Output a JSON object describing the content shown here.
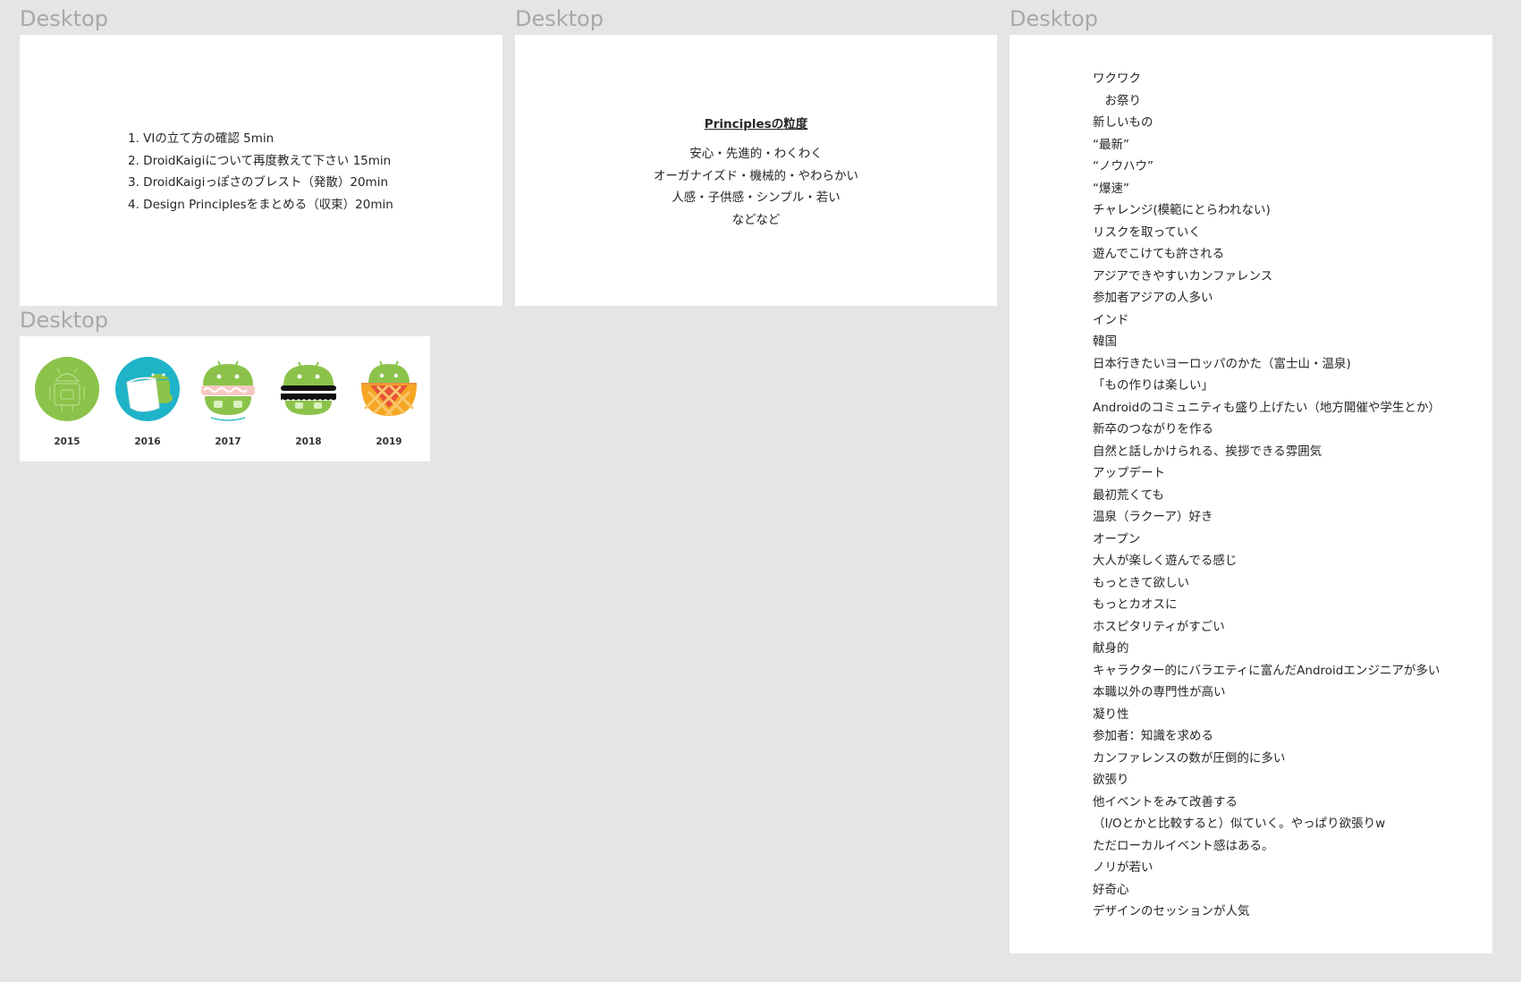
{
  "frames": {
    "agenda": {
      "label": "Desktop",
      "items": [
        "1. VIの立て方の確認 5min",
        "2. DroidKaigiについて再度教えて下さい  15min",
        "3. DroidKaigiっぽさのブレスト（発散）20min",
        "4. Design Principlesをまとめる（収束）20min"
      ]
    },
    "principles": {
      "label": "Desktop",
      "heading": "Principlesの粒度",
      "lines": [
        "安心・先進的・わくわく",
        "オーガナイズド・機械的・やわらかい",
        "人感・子供感・シンプル・若い",
        "などなど"
      ]
    },
    "notes": {
      "label": "Desktop",
      "items": [
        "ワクワク",
        "　お祭り",
        "新しいもの",
        "“最新”",
        "“ノウハウ”",
        "“爆速”",
        "チャレンジ(模範にとらわれない)",
        "リスクを取っていく",
        "遊んでこけても許される",
        "アジアできやすいカンファレンス",
        "参加者アジアの人多い",
        "インド",
        "韓国",
        "日本行きたいヨーロッパのかた（富士山・温泉)",
        "「もの作りは楽しい」",
        "Androidのコミュニティも盛り上げたい（地方開催や学生とか）",
        "新卒のつながりを作る",
        "自然と話しかけられる、挨拶できる雰囲気",
        "アップデート",
        "最初荒くても",
        "温泉（ラクーア）好き",
        "オープン",
        "大人が楽しく遊んでる感じ",
        "もっときて欲しい",
        "もっとカオスに",
        "ホスピタリティがすごい",
        "献身的",
        "キャラクター的にバラエティに富んだAndroidエンジニアが多い",
        "本職以外の専門性が高い",
        "凝り性",
        "参加者：知識を求める",
        "カンファレンスの数が圧倒的に多い",
        "欲張り",
        "他イベントをみて改善する",
        "（I/Oとかと比較すると）似ていく。やっぱり欲張りw",
        "ただローカルイベント感はある。",
        "ノリが若い",
        "好奇心",
        "デザインのセッションが人気"
      ]
    },
    "logos": {
      "label": "Desktop",
      "items": [
        {
          "year": "2015",
          "icon": "robot-outline-icon"
        },
        {
          "year": "2016",
          "icon": "robot-cake-icon"
        },
        {
          "year": "2017",
          "icon": "robot-sandwich-icon"
        },
        {
          "year": "2018",
          "icon": "robot-burger-icon"
        },
        {
          "year": "2019",
          "icon": "robot-pie-icon"
        }
      ]
    }
  },
  "colors": {
    "canvas": "#e5e5e5",
    "frame": "#ffffff",
    "label": "#a8a8a8",
    "android_green": "#8bc34a",
    "teal": "#1fb3c8",
    "pie_orange": "#f5a623",
    "pie_red": "#e8503a"
  }
}
